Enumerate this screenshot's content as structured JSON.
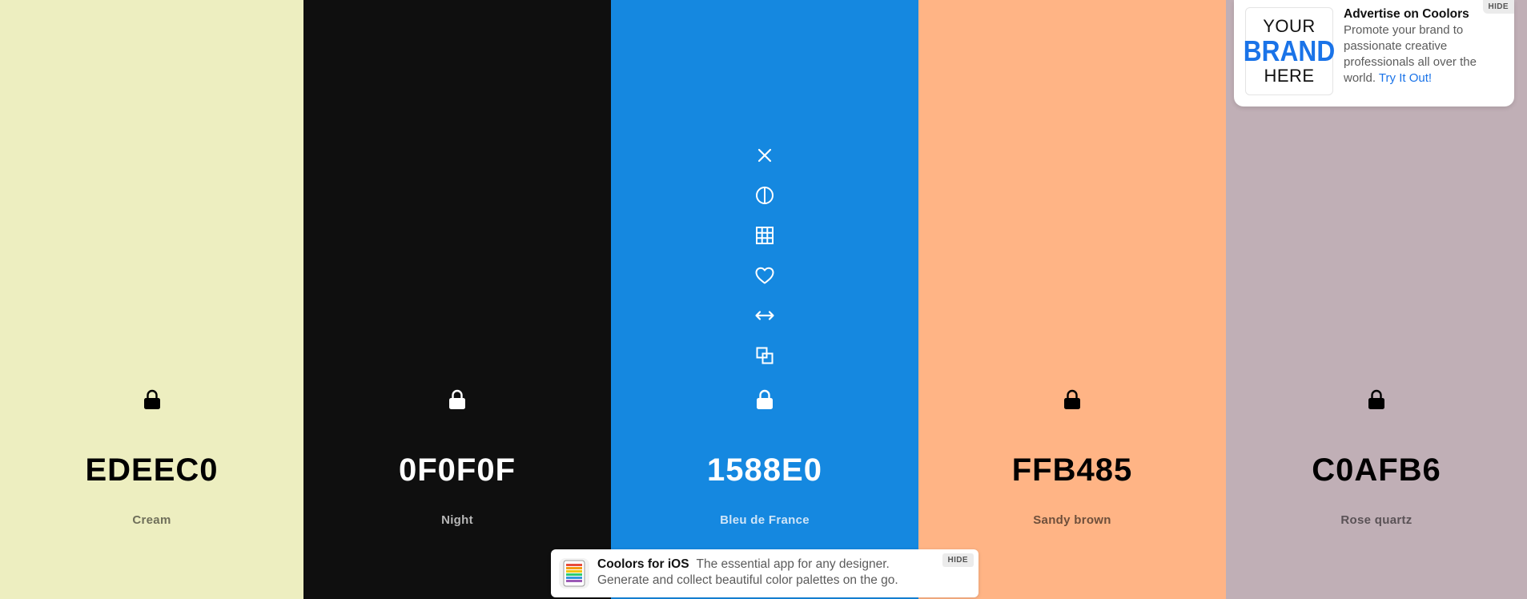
{
  "palette": {
    "colors": [
      {
        "hex": "EDEEC0",
        "name": "Cream",
        "bg": "#EDEEC0",
        "fg": "#000000",
        "name_color": "#6f6f5a"
      },
      {
        "hex": "0F0F0F",
        "name": "Night",
        "bg": "#0F0F0F",
        "fg": "#FFFFFF",
        "name_color": "#b7b7b7"
      },
      {
        "hex": "1588E0",
        "name": "Bleu de France",
        "bg": "#1588E0",
        "fg": "#FFFFFF",
        "name_color": "#cfe5f8"
      },
      {
        "hex": "FFB485",
        "name": "Sandy brown",
        "bg": "#FFB485",
        "fg": "#000000",
        "name_color": "#6e4f3b"
      },
      {
        "hex": "C0AFB6",
        "name": "Rose quartz",
        "bg": "#C0AFB6",
        "fg": "#000000",
        "name_color": "#5a5256"
      }
    ],
    "active_index": 2,
    "tool_icons": [
      "close-icon",
      "contrast-icon",
      "shades-grid-icon",
      "heart-icon",
      "drag-arrows-icon",
      "copy-icon"
    ],
    "lock_icon": "lock-icon"
  },
  "ad": {
    "logo_top": "YOUR",
    "logo_middle": "BRAND",
    "logo_bottom": "HERE",
    "title": "Advertise on Coolors",
    "body": "Promote your brand to passionate creative professionals all over the world.",
    "cta": "Try It Out!",
    "hide_label": "HIDE",
    "accent": "#1a73e8"
  },
  "ios_banner": {
    "title": "Coolors for iOS",
    "line1": "The essential app for any designer.",
    "line2": "Generate and collect beautiful color palettes on the go.",
    "hide_label": "HIDE"
  }
}
